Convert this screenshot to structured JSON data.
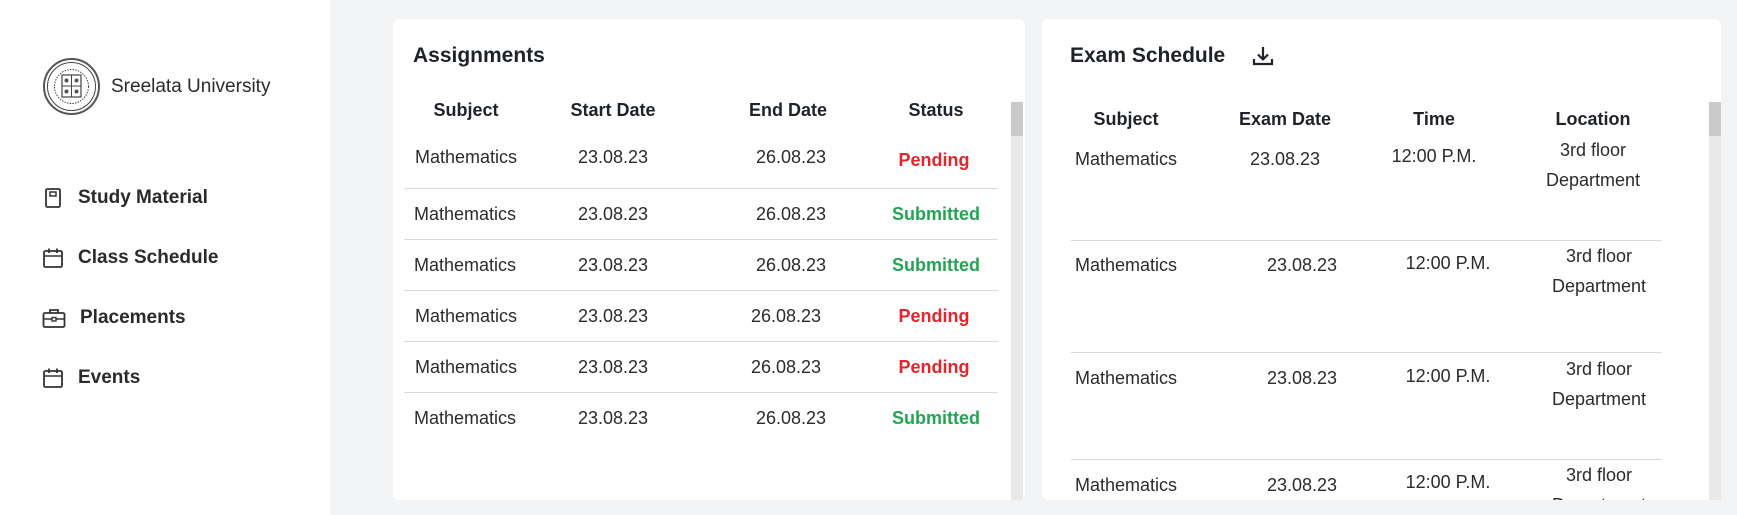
{
  "sidebar": {
    "university_name": "Sreelata University",
    "items": [
      {
        "label": "Study Material",
        "icon": "book-icon"
      },
      {
        "label": "Class Schedule",
        "icon": "calendar-icon"
      },
      {
        "label": "Placements",
        "icon": "briefcase-icon"
      },
      {
        "label": "Events",
        "icon": "calendar-icon"
      }
    ]
  },
  "assignments": {
    "title": "Assignments",
    "headers": [
      "Subject",
      "Start Date",
      "End Date",
      "Status"
    ],
    "rows": [
      {
        "subject": "Mathematics",
        "start": "23.08.23",
        "end": "26.08.23",
        "status": "Pending"
      },
      {
        "subject": "Mathematics",
        "start": "23.08.23",
        "end": "26.08.23",
        "status": "Submitted"
      },
      {
        "subject": "Mathematics",
        "start": "23.08.23",
        "end": "26.08.23",
        "status": "Submitted"
      },
      {
        "subject": "Mathematics",
        "start": "23.08.23",
        "end": "26.08.23",
        "status": "Pending"
      },
      {
        "subject": "Mathematics",
        "start": "23.08.23",
        "end": "26.08.23",
        "status": "Pending"
      },
      {
        "subject": "Mathematics",
        "start": "23.08.23",
        "end": "26.08.23",
        "status": "Submitted"
      }
    ]
  },
  "exam_schedule": {
    "title": "Exam Schedule",
    "headers": [
      "Subject",
      "Exam Date",
      "Time",
      "Location"
    ],
    "rows": [
      {
        "subject": "Mathematics",
        "date": "23.08.23",
        "time": "12:00 P.M.",
        "location_line1": "3rd floor",
        "location_line2": "Department"
      },
      {
        "subject": "Mathematics",
        "date": "23.08.23",
        "time": "12:00 P.M.",
        "location_line1": "3rd floor",
        "location_line2": "Department"
      },
      {
        "subject": "Mathematics",
        "date": "23.08.23",
        "time": "12:00 P.M.",
        "location_line1": "3rd floor",
        "location_line2": "Department"
      },
      {
        "subject": "Mathematics",
        "date": "23.08.23",
        "time": "12:00 P.M.",
        "location_line1": "3rd floor",
        "location_line2": "Department"
      }
    ]
  },
  "colors": {
    "pending": "#e5242b",
    "submitted": "#22a552",
    "background": "#f3f4f6"
  }
}
